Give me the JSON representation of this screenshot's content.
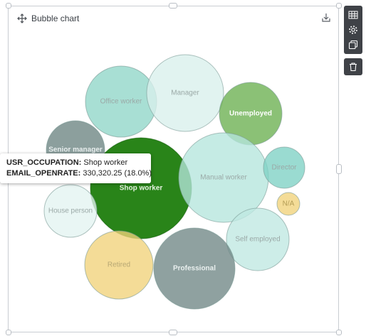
{
  "widget": {
    "title": "Bubble chart",
    "icons": {
      "move": "move-icon",
      "download": "download-icon",
      "table": "table-icon",
      "settings": "gear-icon",
      "duplicate": "copy-icon",
      "delete": "trash-icon"
    }
  },
  "tooltip": {
    "field1_key": "USR_OCCUPATION:",
    "field1_value": "Shop worker",
    "field2_key": "EMAIL_OPENRATE:",
    "field2_value": "330,320.25 (18.0%)"
  },
  "chart_data": {
    "type": "bubble",
    "metric": "EMAIL_OPENRATE",
    "dimension": "USR_OCCUPATION",
    "bubbles": [
      {
        "label": "Office worker",
        "color": "#8fd6c8"
      },
      {
        "label": "Manager",
        "color": "#d8f0ec"
      },
      {
        "label": "Unemployed",
        "color": "#6aaf4f"
      },
      {
        "label": "Senior manager",
        "color": "#6b8481"
      },
      {
        "label": "Shop worker",
        "color": "#1e7d0d",
        "value": 330320.25,
        "share": 18.0
      },
      {
        "label": "Manual worker",
        "color": "#b5e6dd"
      },
      {
        "label": "Director",
        "color": "#7ed1c4"
      },
      {
        "label": "N/A",
        "color": "#f1d27a"
      },
      {
        "label": "House person",
        "color": "#e3f4f1"
      },
      {
        "label": "Self employed",
        "color": "#bfe8e1"
      },
      {
        "label": "Retired",
        "color": "#f1d27a"
      },
      {
        "label": "Professional",
        "color": "#6f8785"
      }
    ]
  }
}
